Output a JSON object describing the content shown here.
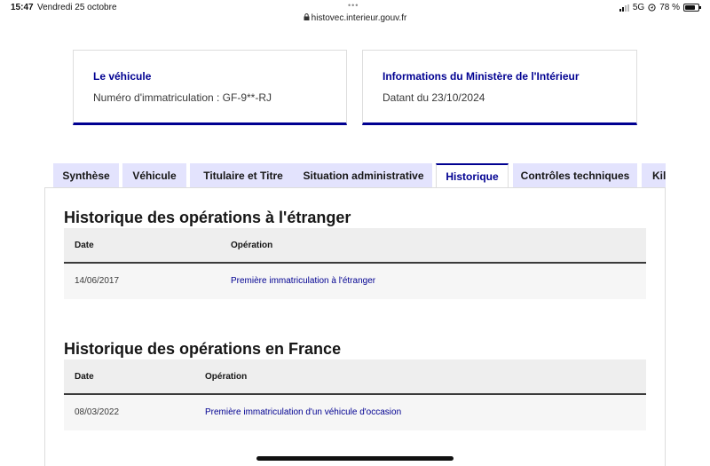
{
  "statusbar": {
    "time": "15:47",
    "date": "Vendredi 25 octobre",
    "dots": "•••",
    "url": "histovec.interieur.gouv.fr",
    "network": "5G",
    "battery": "78 %",
    "battery_level": 0.78,
    "icons": [
      "lock-icon",
      "signal-icon",
      "location-icon",
      "battery-icon"
    ]
  },
  "cards": [
    {
      "title": "Le véhicule",
      "text": "Numéro d'immatriculation : GF-9**-RJ"
    },
    {
      "title": "Informations du Ministère de l'Intérieur",
      "text": "Datant du 23/10/2024"
    }
  ],
  "tabs": [
    {
      "label": "Synthèse",
      "active": false
    },
    {
      "label": "Véhicule",
      "active": false
    },
    {
      "label": "Titulaire et Titre",
      "active": false
    },
    {
      "label": "Situation administrative",
      "active": false
    },
    {
      "label": "Historique",
      "active": true
    },
    {
      "label": "Contrôles techniques",
      "active": false
    },
    {
      "label": "Kilo",
      "active": false
    }
  ],
  "sections": [
    {
      "title": "Historique des opérations à l'étranger",
      "columns": [
        "Date",
        "Opération"
      ],
      "rows": [
        {
          "date": "14/06/2017",
          "operation": "Première immatriculation à l'étranger"
        }
      ]
    },
    {
      "title": "Historique des opérations en France",
      "columns": [
        "Date",
        "Opération"
      ],
      "rows": [
        {
          "date": "08/03/2022",
          "operation": "Première immatriculation d'un véhicule d'occasion"
        }
      ]
    }
  ],
  "colors": {
    "primary": "#000091",
    "tab_bg": "#e3e3fd",
    "table_header_bg": "#eeeeee",
    "table_row_bg": "#f6f6f6"
  }
}
